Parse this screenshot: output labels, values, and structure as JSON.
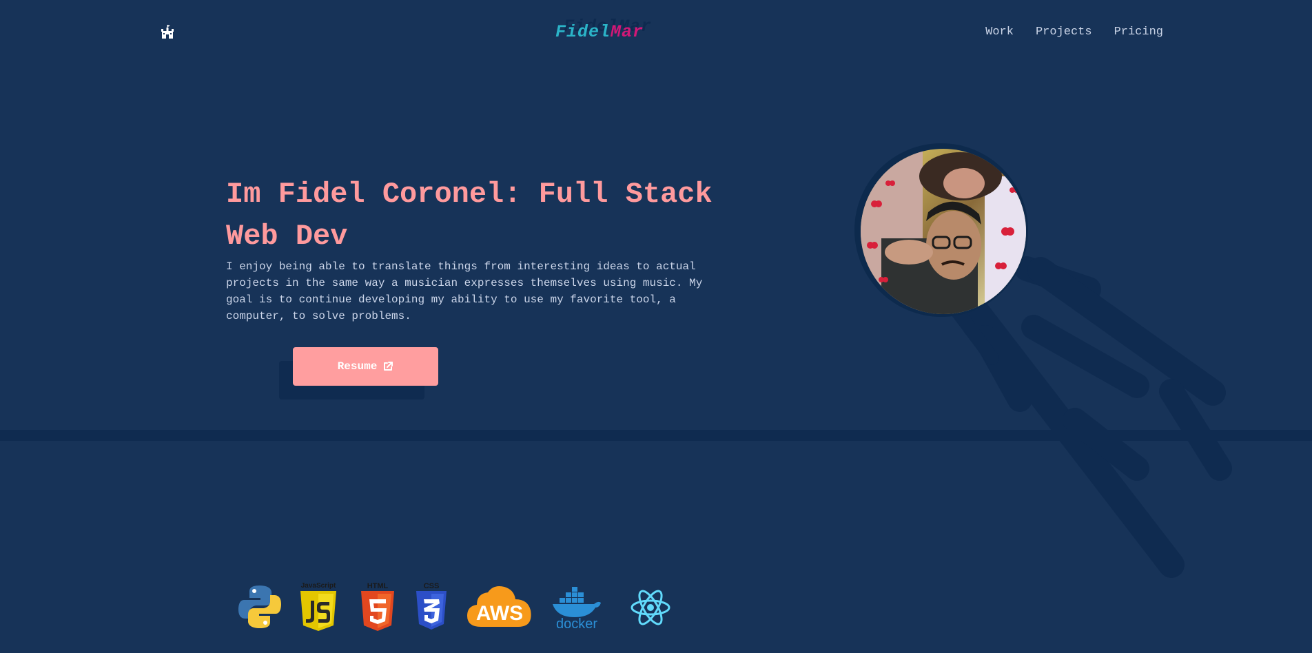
{
  "header": {
    "logo_first": "Fidel",
    "logo_second": "Mar",
    "home_icon": "castle-icon",
    "nav": [
      {
        "label": "Work"
      },
      {
        "label": "Projects"
      },
      {
        "label": "Pricing"
      }
    ]
  },
  "hero": {
    "title": "Im Fidel Coronel: Full Stack Web Dev",
    "description": "I enjoy being able to translate things from interesting ideas to actual projects in the same way a musician expresses themselves using music. My goal is to continue developing my ability to use my favorite tool, a computer, to solve problems.",
    "resume_label": "Resume",
    "resume_icon": "external-link-icon"
  },
  "avatar": {
    "icon": "profile-photo"
  },
  "tech_stack": [
    {
      "name": "python",
      "icon": "python-icon"
    },
    {
      "name": "javascript",
      "icon": "javascript-icon",
      "label": "JavaScript"
    },
    {
      "name": "html",
      "icon": "html5-icon",
      "label": "HTML"
    },
    {
      "name": "css",
      "icon": "css3-icon",
      "label": "CSS"
    },
    {
      "name": "aws",
      "icon": "aws-icon",
      "label": "AWS"
    },
    {
      "name": "docker",
      "icon": "docker-icon",
      "label": "docker"
    },
    {
      "name": "react",
      "icon": "react-icon"
    }
  ],
  "colors": {
    "background": "#173358",
    "accent": "#ff9a9d",
    "logo_first": "#2bb4c8",
    "logo_second": "#d21877"
  }
}
